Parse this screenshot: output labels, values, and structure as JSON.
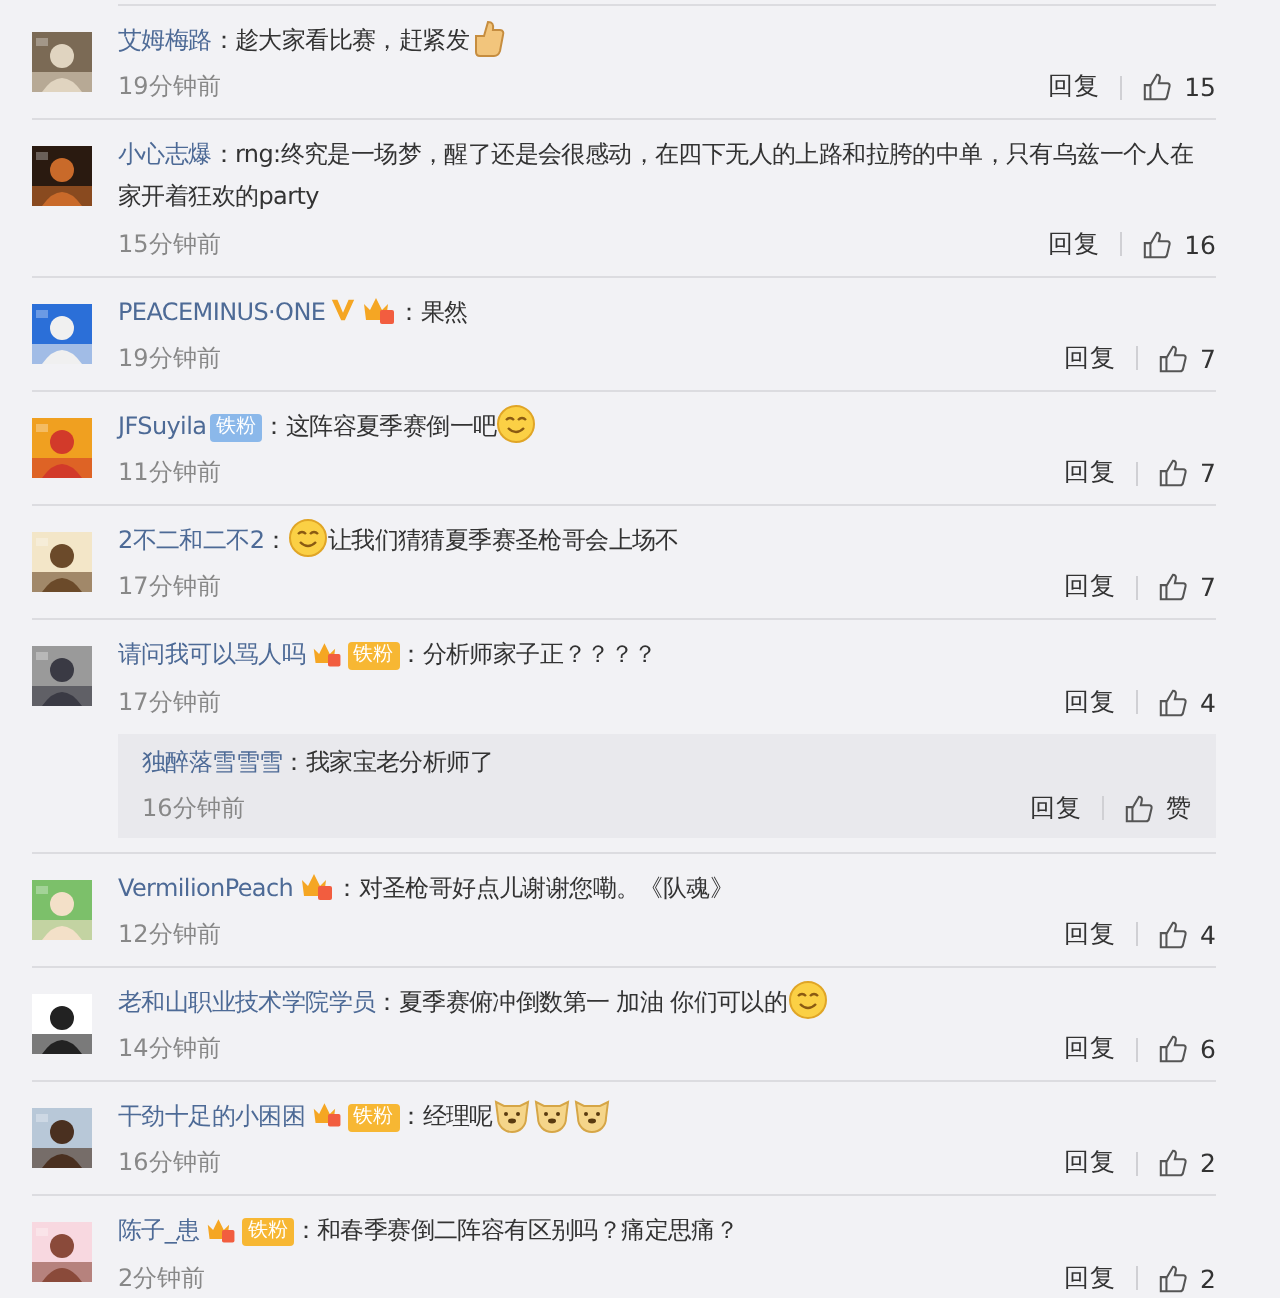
{
  "comments": [
    {
      "name": "艾姆梅路",
      "content": [
        {
          "kind": "text",
          "text": "：趁大家看比赛，赶紧发"
        },
        {
          "kind": "thumbs-up"
        }
      ],
      "time": "19分钟前",
      "reply": "回复",
      "likes": "15"
    },
    {
      "name": "小心志爆",
      "content": [
        {
          "kind": "text",
          "text": "：rng:终究是一场梦，醒了还是会很感动，在四下无人的上路和拉胯的中单，只有乌兹一个人在家开着狂欢的party"
        }
      ],
      "time": "15分钟前",
      "reply": "回复",
      "likes": "16"
    },
    {
      "name": "PEACEMINUS·ONE",
      "badges": [
        {
          "kind": "vip"
        },
        {
          "kind": "crown"
        }
      ],
      "content": [
        {
          "kind": "text",
          "text": "：果然"
        }
      ],
      "time": "19分钟前",
      "reply": "回复",
      "likes": "7"
    },
    {
      "name": "JFSuyila",
      "badges": [
        {
          "kind": "fan-blue",
          "label": "铁粉"
        }
      ],
      "content": [
        {
          "kind": "text",
          "text": "：这阵容夏季赛倒一吧"
        },
        {
          "kind": "face"
        }
      ],
      "time": "11分钟前",
      "reply": "回复",
      "likes": "7"
    },
    {
      "name": "2不二和二不2",
      "content": [
        {
          "kind": "text",
          "text": "："
        },
        {
          "kind": "face"
        },
        {
          "kind": "text",
          "text": "让我们猜猜夏季赛圣枪哥会上场不"
        }
      ],
      "time": "17分钟前",
      "reply": "回复",
      "likes": "7"
    },
    {
      "name": "请问我可以骂人吗",
      "badges": [
        {
          "kind": "crown-fan",
          "label": "铁粉"
        }
      ],
      "content": [
        {
          "kind": "text",
          "text": "：分析师家子正？？？？"
        }
      ],
      "time": "17分钟前",
      "reply": "回复",
      "likes": "4",
      "replies": [
        {
          "name": "独醉落雪雪雪",
          "content": [
            {
              "kind": "text",
              "text": "：我家宝老分析师了"
            }
          ],
          "time": "16分钟前",
          "reply": "回复",
          "likes": "赞"
        }
      ]
    },
    {
      "name": "VermilionPeach",
      "badges": [
        {
          "kind": "crown"
        }
      ],
      "content": [
        {
          "kind": "text",
          "text": "：对圣枪哥好点儿谢谢您嘞。《队魂》"
        }
      ],
      "time": "12分钟前",
      "reply": "回复",
      "likes": "4"
    },
    {
      "name": "老和山职业技术学院学员",
      "content": [
        {
          "kind": "text",
          "text": "：夏季赛俯冲倒数第一 加油 你们可以的"
        },
        {
          "kind": "face"
        }
      ],
      "time": "14分钟前",
      "reply": "回复",
      "likes": "6"
    },
    {
      "name": "干劲十足的小困困",
      "badges": [
        {
          "kind": "crown-fan",
          "label": "铁粉"
        }
      ],
      "content": [
        {
          "kind": "text",
          "text": "：经理呢"
        },
        {
          "kind": "dog"
        },
        {
          "kind": "dog"
        },
        {
          "kind": "dog"
        }
      ],
      "time": "16分钟前",
      "reply": "回复",
      "likes": "2"
    },
    {
      "name": "陈子_患",
      "badges": [
        {
          "kind": "crown-fan",
          "label": "铁粉"
        }
      ],
      "content": [
        {
          "kind": "text",
          "text": "：和春季赛倒二阵容有区别吗？痛定思痛？"
        }
      ],
      "time": "2分钟前",
      "reply": "回复",
      "likes": "2"
    }
  ]
}
